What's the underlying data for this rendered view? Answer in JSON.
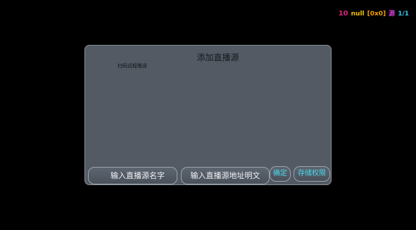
{
  "status_bar": {
    "time": "10",
    "null_text": "null",
    "size_text": "[0x0]",
    "source_text": "源",
    "page_text": "1/1"
  },
  "dialog": {
    "title": "添加直播源",
    "scan_hint": "扫码远程推送",
    "buttons": {
      "name_input": "输入直播源名字",
      "url_input": "输入直播源地址明文",
      "confirm": "确定",
      "storage_permission": "存储权限"
    }
  },
  "colors": {
    "background": "#000000",
    "dialog": "#535a64",
    "accent": "#4ad8ea"
  }
}
